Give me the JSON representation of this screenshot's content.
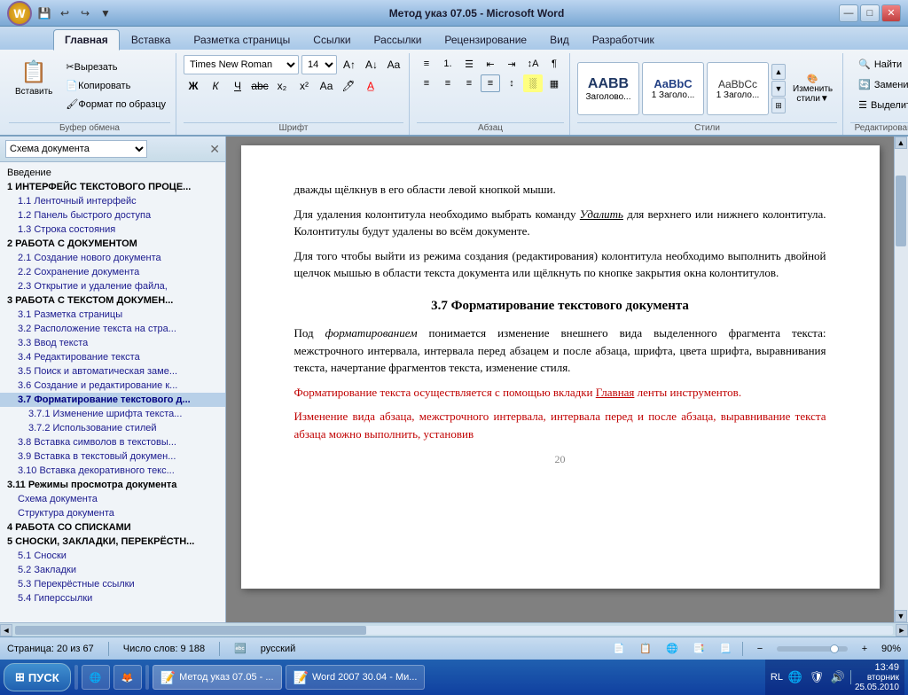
{
  "titleBar": {
    "title": "Метод указ 07.05 - Microsoft Word",
    "minBtn": "—",
    "maxBtn": "□",
    "closeBtn": "✕",
    "officeBtn": "W",
    "quickAccess": [
      "💾",
      "↩",
      "↪",
      "▼"
    ]
  },
  "ribbon": {
    "tabs": [
      "Главная",
      "Вставка",
      "Разметка страницы",
      "Ссылки",
      "Рассылки",
      "Рецензирование",
      "Вид",
      "Разработчик"
    ],
    "activeTab": 0,
    "font": {
      "name": "Times New Roman",
      "size": "14",
      "boldBtn": "Ж",
      "italicBtn": "К",
      "underlineBtn": "Ч",
      "strikeBtn": "abc",
      "subBtn": "x₂",
      "supBtn": "x²",
      "clearBtn": "Aa"
    },
    "groups": {
      "clipboard": "Буфер обмена",
      "font": "Шрифт",
      "paragraph": "Абзац",
      "styles": "Стили",
      "editing": "Редактирование"
    },
    "styles": [
      {
        "name": "AABB",
        "label": "Заголово..."
      },
      {
        "name": "AaBbC",
        "label": "1 Заголо..."
      },
      {
        "name": "AaBbCc",
        "label": "1 Заголо..."
      }
    ],
    "findBtn": "Найти",
    "replaceBtn": "Заменить",
    "selectBtn": "Выделить",
    "changeStyles": "Изменить\nстили"
  },
  "sidebar": {
    "title": "Схема документа",
    "items": [
      {
        "level": "heading",
        "text": "Введение"
      },
      {
        "level": "level1",
        "text": "1 ИНТЕРФЕЙС ТЕКСТОВОГО ПРОЦЕ..."
      },
      {
        "level": "level2",
        "text": "1.1 Ленточный интерфейс"
      },
      {
        "level": "level2",
        "text": "1.2 Панель быстрого доступа"
      },
      {
        "level": "level2",
        "text": "1.3 Строка состояния"
      },
      {
        "level": "level1",
        "text": "2 РАБОТА С ДОКУМЕНТОМ"
      },
      {
        "level": "level2",
        "text": "2.1 Создание нового документа"
      },
      {
        "level": "level2",
        "text": "2.2 Сохранение документа"
      },
      {
        "level": "level2",
        "text": "2.3 Открытие и удаление файла,"
      },
      {
        "level": "level1",
        "text": "3 РАБОТА С ТЕКСТОМ ДОКУМЕН..."
      },
      {
        "level": "level2",
        "text": "3.1 Разметка страницы"
      },
      {
        "level": "level2",
        "text": "3.2 Расположение текста на стра..."
      },
      {
        "level": "level2",
        "text": "3.3 Ввод текста"
      },
      {
        "level": "level2",
        "text": "3.4 Редактирование текста"
      },
      {
        "level": "level2",
        "text": "3.5 Поиск и автоматическая заме..."
      },
      {
        "level": "level2",
        "text": "3.6 Создание и редактирование к..."
      },
      {
        "level": "level2 active",
        "text": "3.7 Форматирование текстового д..."
      },
      {
        "level": "level3",
        "text": "3.7.1 Изменение шрифта текста..."
      },
      {
        "level": "level3",
        "text": "3.7.2 Использование стилей"
      },
      {
        "level": "level2",
        "text": "3.8 Вставка символов в текстовы..."
      },
      {
        "level": "level2",
        "text": "3.9 Вставка в текстовый докумен..."
      },
      {
        "level": "level2",
        "text": "3.10 Вставка декоративного текс..."
      },
      {
        "level": "level1",
        "text": "3.11 Режимы просмотра документа"
      },
      {
        "level": "level2",
        "text": "Схема документа"
      },
      {
        "level": "level2",
        "text": "Структура документа"
      },
      {
        "level": "level1",
        "text": "4 РАБОТА СО СПИСКАМИ"
      },
      {
        "level": "level1",
        "text": "5 СНОСКИ, ЗАКЛАДКИ, ПЕРЕКРЁСТН..."
      },
      {
        "level": "level2",
        "text": "5.1 Сноски"
      },
      {
        "level": "level2",
        "text": "5.2 Закладки"
      },
      {
        "level": "level2",
        "text": "5.3 Перекрёстные ссылки"
      },
      {
        "level": "level2",
        "text": "5.4 Гиперссылки"
      }
    ]
  },
  "document": {
    "paragraphs": [
      {
        "type": "normal",
        "text": "дважды щёлкнув в его области левой кнопкой мыши."
      },
      {
        "type": "normal",
        "text": "Для удаления колонтитула необходимо выбрать команду Удалить для верхнего или нижнего колонтитула. Колонтитулы будут удалены во всём документе."
      },
      {
        "type": "normal",
        "text": "Для того чтобы выйти из режима создания (редактирования) колонтитула необходимо выполнить двойной щелчок мышью в области текста документа или щёлкнуть по кнопке закрытия окна колонтитулов."
      },
      {
        "type": "heading",
        "text": "3.7 Форматирование текстового документа"
      },
      {
        "type": "normal",
        "text": "Под форматированием понимается изменение внешнего вида выделенного фрагмента текста: межстрочного интервала, интервала перед абзацем и после абзаца, шрифта, цвета шрифта, выравнивания текста, начертание фрагментов текста, изменение стиля."
      },
      {
        "type": "red",
        "text": "Форматирование текста осуществляется с помощью вкладки Главная ленты инструментов."
      },
      {
        "type": "red",
        "text": "Изменение вида абзаца, межстрочного интервала, интервала перед и после абзаца, выравнивание текста абзаца можно выполнить, установив"
      }
    ],
    "pageNumber": "20",
    "deleteUnderline": "Удалить"
  },
  "statusBar": {
    "page": "Страница: 20 из 67",
    "words": "Число слов: 9 188",
    "language": "русский",
    "zoom": "90%",
    "viewBtns": [
      "📄",
      "📋",
      "📑"
    ]
  },
  "taskbar": {
    "startBtn": "ПУСК",
    "items": [
      {
        "label": "Метод указ 07.05 - ...",
        "icon": "📝",
        "active": true
      },
      {
        "label": "Word 2007 30.04 - Ми...",
        "icon": "📝",
        "active": false
      }
    ],
    "trayIcons": [
      "RL",
      "🔊",
      "📶"
    ],
    "time": "13:49",
    "dayOfWeek": "вторник",
    "date": "25.05.2010"
  }
}
